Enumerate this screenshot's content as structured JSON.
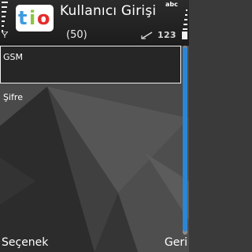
{
  "window": {
    "title": "Kullanıcı Girişi",
    "subtitle": "(50)",
    "app_logo_text": "tio",
    "input_mode": "123",
    "top_right_indicator": "abc"
  },
  "status_icons": [
    "signal-strength-icon",
    "antenna-icon",
    "app-logo-icon",
    "pen-input-icon",
    "keyboard-mode-icon",
    "battery-level-icon",
    "battery-icon"
  ],
  "form": {
    "fields": [
      {
        "label": "GSM",
        "value": ""
      },
      {
        "label": "Şifre",
        "value": ""
      }
    ]
  },
  "softkeys": {
    "left": "Seçenek",
    "right": "Geri"
  },
  "colors": {
    "accent": "#2b86d6",
    "logo_t": "#3d9be0",
    "logo_i": "#8cc63f",
    "logo_o": "#e52b2b"
  }
}
